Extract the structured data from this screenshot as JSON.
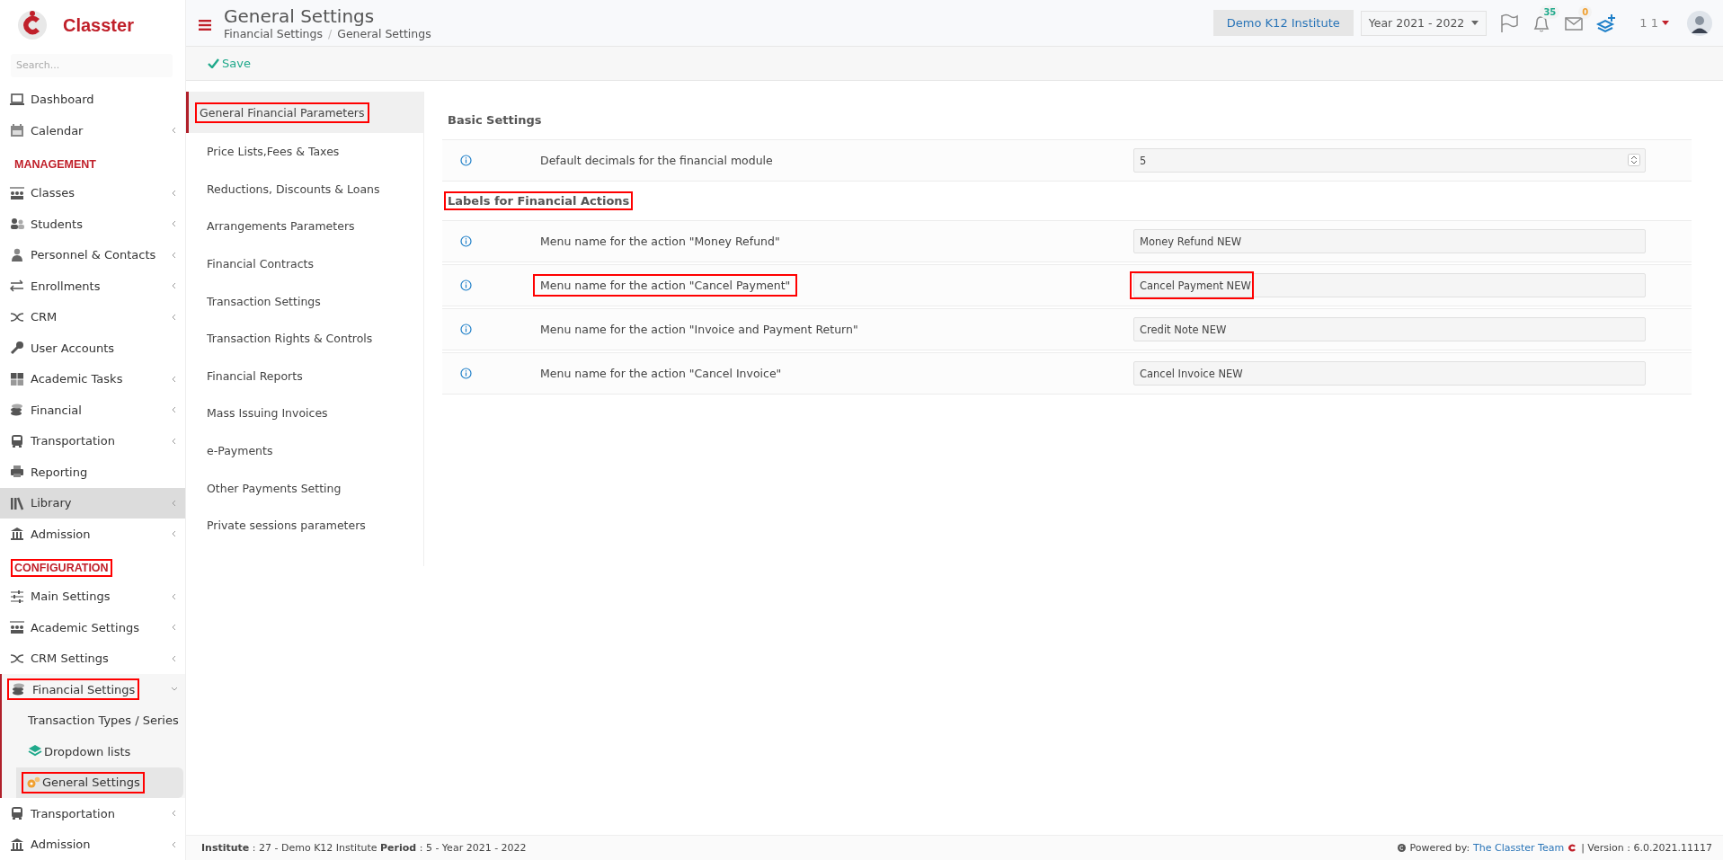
{
  "brand": {
    "name": "Classter"
  },
  "search": {
    "placeholder": "Search..."
  },
  "header": {
    "title": "General Settings",
    "breadcrumb": [
      "Financial Settings",
      "General Settings"
    ],
    "breadcrumb_separator": "/",
    "institute": "Demo K12 Institute",
    "year": "Year 2021 - 2022",
    "notifications": "35",
    "messages": "0",
    "user": "1 1"
  },
  "toolbar": {
    "save": "Save"
  },
  "sidebar": [
    {
      "kind": "item",
      "label": "Dashboard",
      "expandable": false,
      "selected": false
    },
    {
      "kind": "item",
      "label": "Calendar",
      "expandable": true,
      "selected": false
    },
    {
      "kind": "heading",
      "label": "MANAGEMENT",
      "annotated": false
    },
    {
      "kind": "item",
      "label": "Classes",
      "expandable": true,
      "selected": false
    },
    {
      "kind": "item",
      "label": "Students",
      "expandable": true,
      "selected": false
    },
    {
      "kind": "item",
      "label": "Personnel & Contacts",
      "expandable": true,
      "selected": false
    },
    {
      "kind": "item",
      "label": "Enrollments",
      "expandable": true,
      "selected": false
    },
    {
      "kind": "item",
      "label": "CRM",
      "expandable": true,
      "selected": false
    },
    {
      "kind": "item",
      "label": "User Accounts",
      "expandable": false,
      "selected": false
    },
    {
      "kind": "item",
      "label": "Academic Tasks",
      "expandable": true,
      "selected": false
    },
    {
      "kind": "item",
      "label": "Financial",
      "expandable": true,
      "selected": false
    },
    {
      "kind": "item",
      "label": "Transportation",
      "expandable": true,
      "selected": false
    },
    {
      "kind": "item",
      "label": "Reporting",
      "expandable": false,
      "selected": false
    },
    {
      "kind": "item",
      "label": "Library",
      "expandable": true,
      "selected": true
    },
    {
      "kind": "item",
      "label": "Admission",
      "expandable": true,
      "selected": false
    },
    {
      "kind": "heading",
      "label": "CONFIGURATION",
      "annotated": true
    },
    {
      "kind": "item",
      "label": "Main Settings",
      "expandable": true,
      "selected": false
    },
    {
      "kind": "item",
      "label": "Academic Settings",
      "expandable": true,
      "selected": false
    },
    {
      "kind": "item",
      "label": "CRM Settings",
      "expandable": true,
      "selected": false
    },
    {
      "kind": "item",
      "label": "Financial Settings",
      "expandable": true,
      "expanded": true,
      "annotated": true,
      "selected": false,
      "children": [
        {
          "label": "Transaction Types / Series",
          "selected": false,
          "annotated": false
        },
        {
          "label": "Dropdown lists",
          "selected": false,
          "annotated": false
        },
        {
          "label": "General Settings",
          "selected": true,
          "annotated": true
        }
      ]
    },
    {
      "kind": "item",
      "label": "Transportation",
      "expandable": true,
      "selected": false
    },
    {
      "kind": "item",
      "label": "Admission",
      "expandable": true,
      "selected": false
    }
  ],
  "settings_nav": [
    {
      "label": "General Financial Parameters",
      "selected": true,
      "annotated": true
    },
    {
      "label": "Price Lists,Fees & Taxes",
      "selected": false,
      "annotated": false
    },
    {
      "label": "Reductions, Discounts & Loans",
      "selected": false,
      "annotated": false
    },
    {
      "label": "Arrangements Parameters",
      "selected": false,
      "annotated": false
    },
    {
      "label": "Financial Contracts",
      "selected": false,
      "annotated": false
    },
    {
      "label": "Transaction Settings",
      "selected": false,
      "annotated": false
    },
    {
      "label": "Transaction Rights & Controls",
      "selected": false,
      "annotated": false
    },
    {
      "label": "Financial Reports",
      "selected": false,
      "annotated": false
    },
    {
      "label": "Mass Issuing Invoices",
      "selected": false,
      "annotated": false
    },
    {
      "label": "e-Payments",
      "selected": false,
      "annotated": false
    },
    {
      "label": "Other Payments Setting",
      "selected": false,
      "annotated": false
    },
    {
      "label": "Private sessions parameters",
      "selected": false,
      "annotated": false
    }
  ],
  "sections": [
    {
      "title": "Basic Settings",
      "annotated": false,
      "rows": [
        {
          "kind": "number",
          "label": "Default decimals for the financial module",
          "value": "5",
          "label_annotated": false,
          "value_annotated": false
        }
      ]
    },
    {
      "title": "Labels for Financial Actions",
      "annotated": true,
      "rows": [
        {
          "kind": "text",
          "label": "Menu name for the action \"Money Refund\"",
          "value": "Money Refund NEW",
          "label_annotated": false,
          "value_annotated": false
        },
        {
          "kind": "text",
          "label": "Menu name for the action \"Cancel Payment\"",
          "value": "Cancel Payment NEW",
          "label_annotated": true,
          "value_annotated": true
        },
        {
          "kind": "text",
          "label": "Menu name for the action \"Invoice and Payment Return\"",
          "value": "Credit Note NEW",
          "label_annotated": false,
          "value_annotated": false
        },
        {
          "kind": "text",
          "label": "Menu name for the action \"Cancel Invoice\"",
          "value": "Cancel Invoice NEW",
          "label_annotated": false,
          "value_annotated": false
        }
      ]
    }
  ],
  "footer": {
    "info": "**Institute** : 27 - Demo K12 Institute **Period** : 5 - Year 2021 - 2022",
    "powered": "Powered by:",
    "team": "The Classter Team",
    "version": "| Version : 6.0.2021.11117"
  }
}
